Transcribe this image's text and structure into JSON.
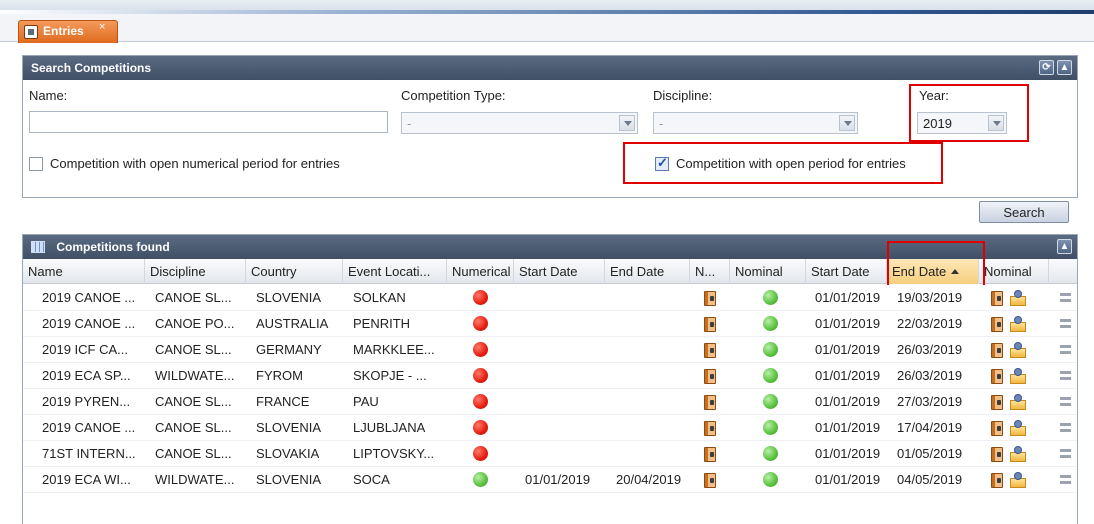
{
  "tab": {
    "label": "Entries",
    "close": "×"
  },
  "search": {
    "title": "Search Competitions",
    "name_label": "Name:",
    "name_value": "",
    "type_label": "Competition Type:",
    "type_value": "-",
    "discipline_label": "Discipline:",
    "discipline_value": "-",
    "year_label": "Year:",
    "year_value": "2019",
    "numerical_checkbox_label": "Competition with open numerical period for entries",
    "numerical_checked": false,
    "open_checkbox_label": "Competition with open period for entries",
    "open_checked": true,
    "search_button": "Search"
  },
  "results": {
    "title": "Competitions found",
    "columns": [
      "Name",
      "Discipline",
      "Country",
      "Event Locati...",
      "Numerical",
      "Start Date",
      "End Date",
      "N...",
      "Nominal",
      "Start Date",
      "End Date",
      "Nominal"
    ],
    "rows": [
      {
        "name": "2019 CANOE ...",
        "discipline": "CANOE SL...",
        "country": "SLOVENIA",
        "location": "SOLKAN",
        "numerical": "red",
        "num_start": "",
        "num_end": "",
        "nominal": "green",
        "start": "01/01/2019",
        "end": "19/03/2019"
      },
      {
        "name": "2019 CANOE ...",
        "discipline": "CANOE PO...",
        "country": "AUSTRALIA",
        "location": "PENRITH",
        "numerical": "red",
        "num_start": "",
        "num_end": "",
        "nominal": "green",
        "start": "01/01/2019",
        "end": "22/03/2019"
      },
      {
        "name": "2019 ICF CA...",
        "discipline": "CANOE SL...",
        "country": "GERMANY",
        "location": "MARKKLEE...",
        "numerical": "red",
        "num_start": "",
        "num_end": "",
        "nominal": "green",
        "start": "01/01/2019",
        "end": "26/03/2019"
      },
      {
        "name": "2019 ECA SP...",
        "discipline": "WILDWATE...",
        "country": "FYROM",
        "location": "SKOPJE - ...",
        "numerical": "red",
        "num_start": "",
        "num_end": "",
        "nominal": "green",
        "start": "01/01/2019",
        "end": "26/03/2019"
      },
      {
        "name": "2019 PYREN...",
        "discipline": "CANOE SL...",
        "country": "FRANCE",
        "location": "PAU",
        "numerical": "red",
        "num_start": "",
        "num_end": "",
        "nominal": "green",
        "start": "01/01/2019",
        "end": "27/03/2019"
      },
      {
        "name": "2019 CANOE ...",
        "discipline": "CANOE SL...",
        "country": "SLOVENIA",
        "location": "LJUBLJANA",
        "numerical": "red",
        "num_start": "",
        "num_end": "",
        "nominal": "green",
        "start": "01/01/2019",
        "end": "17/04/2019"
      },
      {
        "name": "71ST INTERN...",
        "discipline": "CANOE SL...",
        "country": "SLOVAKIA",
        "location": "LIPTOVSKY...",
        "numerical": "red",
        "num_start": "",
        "num_end": "",
        "nominal": "green",
        "start": "01/01/2019",
        "end": "01/05/2019"
      },
      {
        "name": "2019 ECA WI...",
        "discipline": "WILDWATE...",
        "country": "SLOVENIA",
        "location": "SOCA",
        "numerical": "green",
        "num_start": "01/01/2019",
        "num_end": "20/04/2019",
        "nominal": "green",
        "start": "01/01/2019",
        "end": "04/05/2019"
      }
    ]
  },
  "colors": {
    "header_dark": "#46566d",
    "tab_orange": "#e8782d",
    "highlight_red": "#e00000",
    "sorted_header": "#f6cf7d"
  }
}
